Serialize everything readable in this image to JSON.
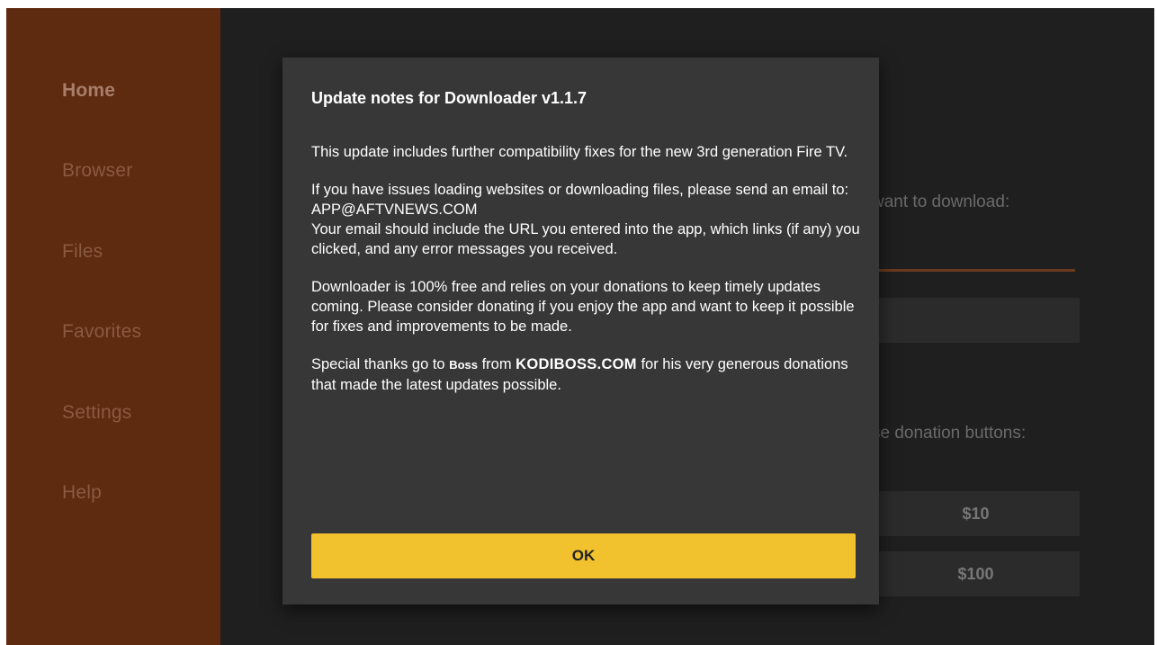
{
  "sidebar": {
    "items": [
      {
        "label": "Home"
      },
      {
        "label": "Browser"
      },
      {
        "label": "Files"
      },
      {
        "label": "Favorites"
      },
      {
        "label": "Settings"
      },
      {
        "label": "Help"
      }
    ]
  },
  "background": {
    "url_prompt_fragment": "want to download:",
    "donation_prompt_fragment": "se donation buttons:",
    "donate_10": "$10",
    "donate_100": "$100"
  },
  "dialog": {
    "title": "Update notes for Downloader v1.1.7",
    "p1": "This update includes further compatibility fixes for the new 3rd generation Fire TV.",
    "p2_line1": "If you have issues loading websites or downloading files, please send an email to: APP@AFTVNEWS.COM",
    "p2_line2": "Your email should include the URL you entered into the app, which links (if any) you clicked, and any error messages you received.",
    "p3": "Downloader is 100% free and relies on your donations to keep timely updates coming. Please consider donating if you enjoy the app and want to keep it possible for fixes and improvements to be made.",
    "p4_prefix": "Special thanks go to ",
    "p4_name": "Boss",
    "p4_from": " from ",
    "p4_site": "KODIBOSS.COM",
    "p4_suffix": " for his very generous donations that made the latest updates possible.",
    "ok_label": "OK"
  },
  "colors": {
    "sidebar_bg": "#5e2a10",
    "dialog_bg": "#373737",
    "ok_button": "#f2c12e",
    "accent_line": "#6b3a1e"
  }
}
